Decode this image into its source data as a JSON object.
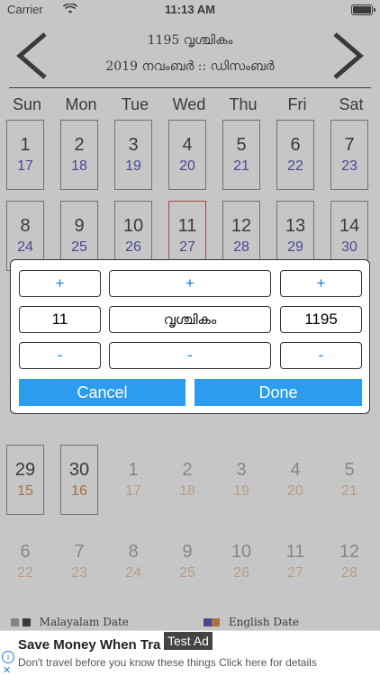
{
  "status_bar": {
    "carrier": "Carrier",
    "time": "11:13 AM"
  },
  "header": {
    "malayalam_year_month": "1195 വൃശ്ചികം",
    "english_year_months": "2019 നവംബർ :: ഡിസംബർ"
  },
  "weekdays": [
    "Sun",
    "Mon",
    "Tue",
    "Wed",
    "Thu",
    "Fri",
    "Sat"
  ],
  "calendar": {
    "row1": [
      {
        "main": "1",
        "sub": "17"
      },
      {
        "main": "2",
        "sub": "18"
      },
      {
        "main": "3",
        "sub": "19"
      },
      {
        "main": "4",
        "sub": "20"
      },
      {
        "main": "5",
        "sub": "21"
      },
      {
        "main": "6",
        "sub": "22"
      },
      {
        "main": "7",
        "sub": "23"
      }
    ],
    "row2": [
      {
        "main": "8",
        "sub": "24"
      },
      {
        "main": "9",
        "sub": "25"
      },
      {
        "main": "10",
        "sub": "26"
      },
      {
        "main": "11",
        "sub": "27"
      },
      {
        "main": "12",
        "sub": "28"
      },
      {
        "main": "13",
        "sub": "29"
      },
      {
        "main": "14",
        "sub": "30"
      }
    ],
    "row5": [
      {
        "main": "29",
        "sub": "15"
      },
      {
        "main": "30",
        "sub": "16"
      },
      {
        "main": "1",
        "sub": "17"
      },
      {
        "main": "2",
        "sub": "18"
      },
      {
        "main": "3",
        "sub": "19"
      },
      {
        "main": "4",
        "sub": "20"
      },
      {
        "main": "5",
        "sub": "21"
      }
    ],
    "row6": [
      {
        "main": "6",
        "sub": "22"
      },
      {
        "main": "7",
        "sub": "23"
      },
      {
        "main": "8",
        "sub": "24"
      },
      {
        "main": "9",
        "sub": "25"
      },
      {
        "main": "10",
        "sub": "26"
      },
      {
        "main": "11",
        "sub": "27"
      },
      {
        "main": "12",
        "sub": "28"
      }
    ]
  },
  "legend": {
    "malayalam_label": "Malayalam Date",
    "english_label": "English Date"
  },
  "dialog": {
    "plus": "+",
    "minus": "-",
    "day_value": "11",
    "month_value": "വൃശ്ചികം",
    "year_value": "1195",
    "cancel_label": "Cancel",
    "done_label": "Done"
  },
  "ad": {
    "headline": "Save Money When Tra",
    "body": "Don't travel before you know these things Click here for details",
    "test_label": "Test Ad"
  },
  "colors": {
    "accent": "#2c9cee",
    "english_date": "#1a1aa0",
    "orange_date": "#cc6600",
    "today_border": "#c0161e"
  }
}
